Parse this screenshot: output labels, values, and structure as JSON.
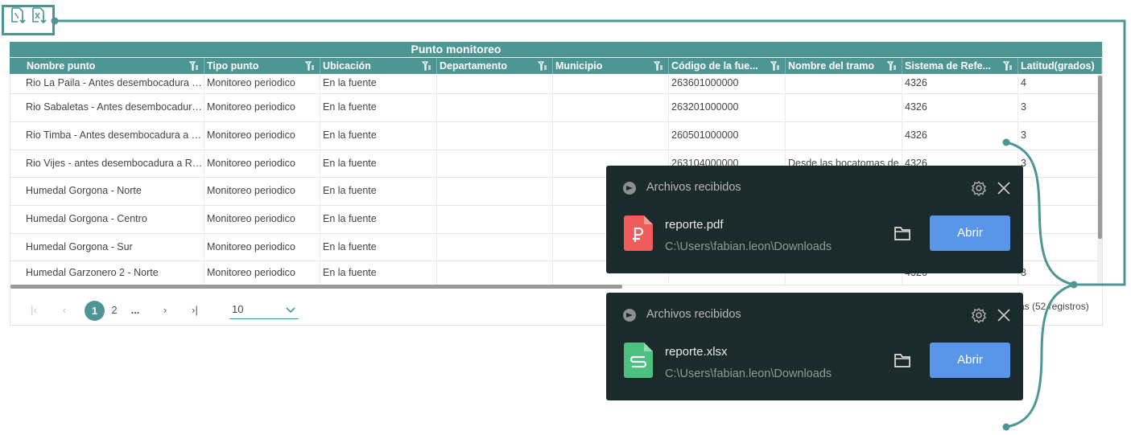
{
  "export": {
    "pdf_icon": "file-download-pdf-icon",
    "excel_icon": "file-download-excel-icon"
  },
  "table": {
    "group_title": "Punto monitoreo",
    "columns": [
      "Nombre punto",
      "Tipo punto",
      "Ubicación",
      "Departamento",
      "Municipio",
      "Código de la fue...",
      "Nombre del tramo",
      "Sistema de Refe...",
      "Latitud(grados)"
    ],
    "rows": [
      [
        "Rio La Paila - Antes desembocadura a Río Cauca",
        "Monitoreo periodico",
        "En la fuente",
        "",
        "",
        "263601000000",
        "",
        "4326",
        "4"
      ],
      [
        "Rio Sabaletas - Antes desembocadura a Río Cauca",
        "Monitoreo periodico",
        "En la fuente",
        "",
        "",
        "263201000000",
        "",
        "4326",
        "3"
      ],
      [
        "Rio Timba - Antes desembocadura a Río Cauca",
        "Monitoreo periodico",
        "En la fuente",
        "",
        "",
        "260501000000",
        "",
        "4326",
        "3"
      ],
      [
        "Rio Vijes - antes desembocadura a Río Cauca",
        "Monitoreo periodico",
        "En la fuente",
        "",
        "",
        "263104000000",
        "Desde las bocatomas de",
        "4326",
        "3"
      ],
      [
        "Humedal Gorgona - Norte",
        "Monitoreo periodico",
        "En la fuente",
        "",
        "",
        "",
        "",
        "",
        ""
      ],
      [
        "Humedal Gorgona - Centro",
        "Monitoreo periodico",
        "En la fuente",
        "",
        "",
        "",
        "",
        "",
        ""
      ],
      [
        "Humedal Gorgona - Sur",
        "Monitoreo periodico",
        "En la fuente",
        "",
        "",
        "",
        "",
        "",
        ""
      ],
      [
        "Humedal Garzonero 2 - Norte",
        "Monitoreo periodico",
        "En la fuente",
        "",
        "",
        "",
        "",
        "4326",
        "3"
      ]
    ]
  },
  "pager": {
    "first": "|‹",
    "prev": "‹",
    "current": "1",
    "page2": "2",
    "ellipsis": "...",
    "next": "›",
    "last": "›|",
    "page_size": "10",
    "info": "as (52 registros)"
  },
  "toasts": [
    {
      "title": "Archivos recibidos",
      "file_name": "reporte.pdf",
      "file_path": "C:\\Users\\fabian.leon\\Downloads",
      "open_label": "Abrir",
      "file_color": "#f05b5b"
    },
    {
      "title": "Archivos recibidos",
      "file_name": "reporte.xlsx",
      "file_path": "C:\\Users\\fabian.leon\\Downloads",
      "open_label": "Abrir",
      "file_color": "#4bc07f"
    }
  ],
  "colors": {
    "accent": "#4e9694",
    "toast_bg": "#1b2b2b",
    "open_button": "#5a96e8"
  }
}
